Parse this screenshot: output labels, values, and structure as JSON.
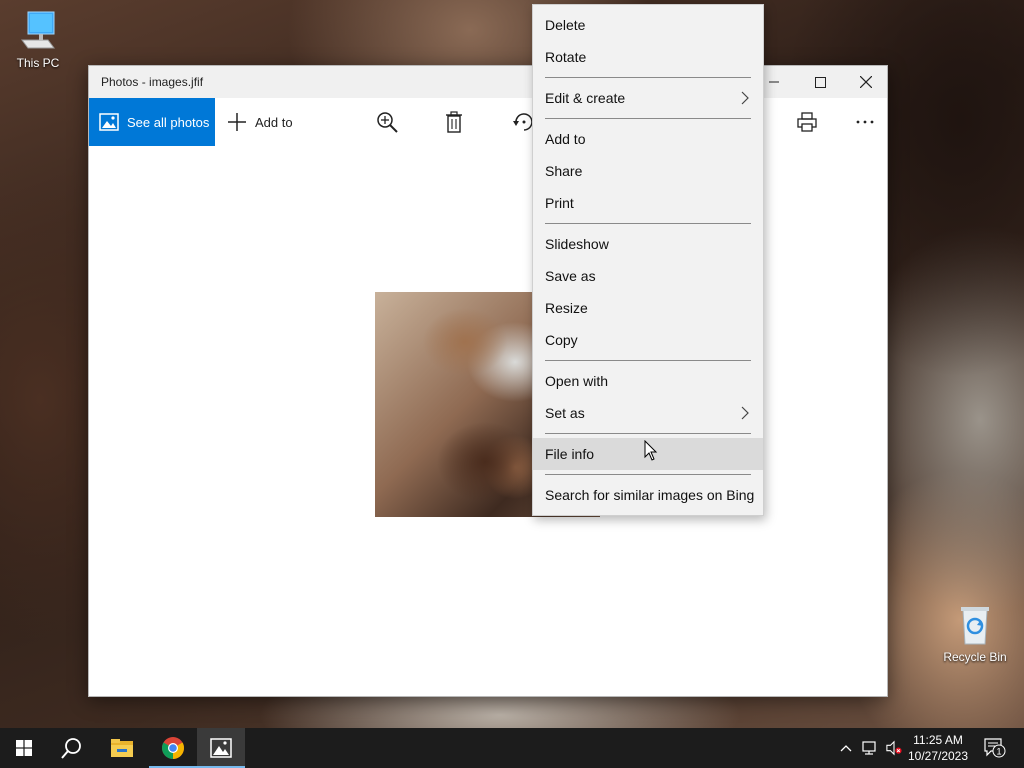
{
  "desktop": {
    "icons": [
      {
        "label": "This PC"
      },
      {
        "label": "Recycle Bin"
      }
    ]
  },
  "window": {
    "title": "Photos - images.jfif",
    "toolbar": {
      "see_all_photos": "See all photos",
      "add_to": "Add to"
    }
  },
  "context_menu": {
    "items": [
      {
        "label": "Delete"
      },
      {
        "label": "Rotate"
      },
      {
        "label": "Edit & create"
      },
      {
        "label": "Add to"
      },
      {
        "label": "Share"
      },
      {
        "label": "Print"
      },
      {
        "label": "Slideshow"
      },
      {
        "label": "Save as"
      },
      {
        "label": "Resize"
      },
      {
        "label": "Copy"
      },
      {
        "label": "Open with"
      },
      {
        "label": "Set as"
      },
      {
        "label": "File info"
      },
      {
        "label": "Search for similar images on Bing"
      }
    ],
    "hovered_item": "File info"
  },
  "taskbar": {
    "time": "11:25 AM",
    "date": "10/27/2023",
    "notification_count": "1"
  },
  "colors": {
    "accent": "#0078d7",
    "taskbar": "#1c1c1c",
    "menu_bg": "#f2f2f2",
    "menu_hover": "#dadada"
  }
}
